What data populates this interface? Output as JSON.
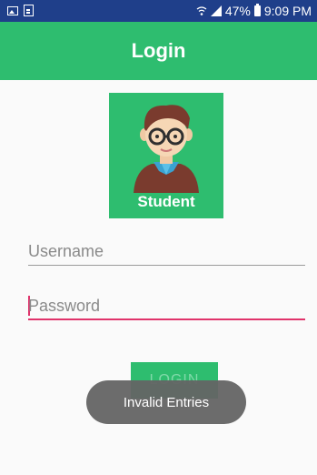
{
  "status_bar": {
    "battery": "47%",
    "time": "9:09 PM",
    "left_icons": [
      "image-icon",
      "document-icon"
    ],
    "right_icons": [
      "wifi-icon",
      "signal-icon",
      "battery-icon"
    ]
  },
  "app_bar": {
    "title": "Login"
  },
  "avatar": {
    "caption": "Student",
    "icon": "student-avatar-icon"
  },
  "form": {
    "username_placeholder": "Username",
    "password_placeholder": "Password",
    "login_label": "LOGIN"
  },
  "toast": {
    "message": "Invalid Entries"
  },
  "colors": {
    "status_bar": "#1f3f8a",
    "primary": "#2ebd6f",
    "accent": "#e0336b",
    "toast": "#646464"
  }
}
